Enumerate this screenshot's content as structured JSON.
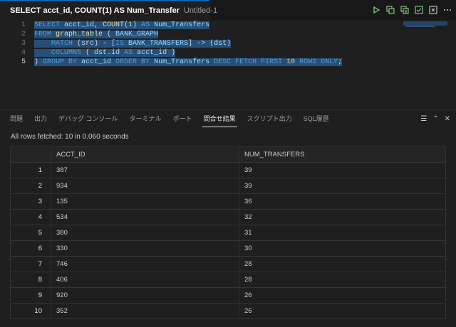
{
  "editor_tab": {
    "title": "SELECT acct_id, COUNT(1) AS Num_Transfer",
    "subtitle": "Untitled-1"
  },
  "toolbar": {
    "icons": [
      "play-icon",
      "run-explain-icon",
      "run-script-icon",
      "commit-icon",
      "rollback-icon",
      "more-icon"
    ]
  },
  "editor": {
    "line_numbers": [
      "1",
      "2",
      "3",
      "4",
      "5"
    ],
    "lines": [
      [
        {
          "t": "SELECT ",
          "c": "kw"
        },
        {
          "t": "acct_id",
          "c": "id"
        },
        {
          "t": ", ",
          "c": "pl"
        },
        {
          "t": "COUNT",
          "c": "fn"
        },
        {
          "t": "(",
          "c": "pl"
        },
        {
          "t": "1",
          "c": "nm"
        },
        {
          "t": ") ",
          "c": "pl"
        },
        {
          "t": "AS ",
          "c": "kw"
        },
        {
          "t": "Num_Transfers",
          "c": "id"
        }
      ],
      [
        {
          "t": "FROM ",
          "c": "kw"
        },
        {
          "t": "graph_table",
          "c": "fn"
        },
        {
          "t": " ( ",
          "c": "pl"
        },
        {
          "t": "BANK_GRAPH",
          "c": "id"
        }
      ],
      [
        {
          "t": "    MATCH ",
          "c": "kw"
        },
        {
          "t": "(src) - [",
          "c": "pl"
        },
        {
          "t": "IS ",
          "c": "kw"
        },
        {
          "t": "BANK_TRANSFERS",
          "c": "id"
        },
        {
          "t": "] -> (dst)",
          "c": "pl"
        }
      ],
      [
        {
          "t": "    COLUMNS ",
          "c": "kw"
        },
        {
          "t": "( ",
          "c": "pl"
        },
        {
          "t": "dst",
          "c": "id"
        },
        {
          "t": ".",
          "c": "pl"
        },
        {
          "t": "id ",
          "c": "id"
        },
        {
          "t": "AS ",
          "c": "kw"
        },
        {
          "t": "acct_id",
          "c": "id"
        },
        {
          "t": " )",
          "c": "pl"
        }
      ],
      [
        {
          "t": ") ",
          "c": "pl"
        },
        {
          "t": "GROUP BY ",
          "c": "kw"
        },
        {
          "t": "acct_id ",
          "c": "id"
        },
        {
          "t": "ORDER BY ",
          "c": "kw"
        },
        {
          "t": "Num_Transfers ",
          "c": "id"
        },
        {
          "t": "DESC FETCH FIRST ",
          "c": "kw"
        },
        {
          "t": "10 ",
          "c": "nm"
        },
        {
          "t": "ROWS ONLY",
          "c": "kw"
        },
        {
          "t": ";",
          "c": "pl"
        }
      ]
    ]
  },
  "panel": {
    "tabs": [
      "問題",
      "出力",
      "デバッグ コンソール",
      "ターミナル",
      "ポート",
      "問合せ結果",
      "スクリプト出力",
      "SQL履歴"
    ],
    "active_tab": "問合せ結果",
    "action_icons": [
      "collapse-icon",
      "maximize-icon",
      "close-icon"
    ]
  },
  "results": {
    "status": "All rows fetched: 10 in 0.060 seconds",
    "columns": [
      "ACCT_ID",
      "NUM_TRANSFERS"
    ],
    "rows": [
      [
        "1",
        "387",
        "39"
      ],
      [
        "2",
        "934",
        "39"
      ],
      [
        "3",
        "135",
        "36"
      ],
      [
        "4",
        "534",
        "32"
      ],
      [
        "5",
        "380",
        "31"
      ],
      [
        "6",
        "330",
        "30"
      ],
      [
        "7",
        "746",
        "28"
      ],
      [
        "8",
        "406",
        "28"
      ],
      [
        "9",
        "920",
        "26"
      ],
      [
        "10",
        "352",
        "26"
      ]
    ]
  },
  "colors": {
    "accent": "#0078d4",
    "run_green": "#89d185",
    "selection": "#264f78"
  }
}
